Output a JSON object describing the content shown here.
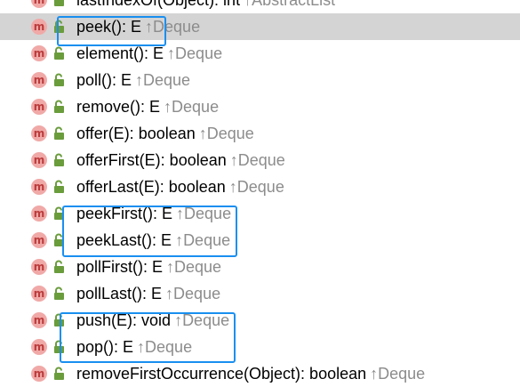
{
  "colors": {
    "method_icon_bg": "#f0a9a7",
    "method_icon_fg": "#bb3b3b",
    "lock_icon": "#6a9c3c",
    "inherited_origin": "#8c8c8c",
    "highlight_border": "#1a8ff0",
    "selected_row_bg": "#d4d4d4"
  },
  "icon_letter": "m",
  "up_arrow": "↑",
  "rows": [
    {
      "sig": "lastIndexOf(Object): int",
      "origin": "AbstractList"
    },
    {
      "sig": "peek(): E",
      "origin": "Deque"
    },
    {
      "sig": "element(): E",
      "origin": "Deque"
    },
    {
      "sig": "poll(): E",
      "origin": "Deque"
    },
    {
      "sig": "remove(): E",
      "origin": "Deque"
    },
    {
      "sig": "offer(E): boolean",
      "origin": "Deque"
    },
    {
      "sig": "offerFirst(E): boolean",
      "origin": "Deque"
    },
    {
      "sig": "offerLast(E): boolean",
      "origin": "Deque"
    },
    {
      "sig": "peekFirst(): E",
      "origin": "Deque"
    },
    {
      "sig": "peekLast(): E",
      "origin": "Deque"
    },
    {
      "sig": "pollFirst(): E",
      "origin": "Deque"
    },
    {
      "sig": "pollLast(): E",
      "origin": "Deque"
    },
    {
      "sig": "push(E): void",
      "origin": "Deque"
    },
    {
      "sig": "pop(): E",
      "origin": "Deque"
    },
    {
      "sig": "removeFirstOccurrence(Object): boolean",
      "origin": "Deque"
    }
  ]
}
